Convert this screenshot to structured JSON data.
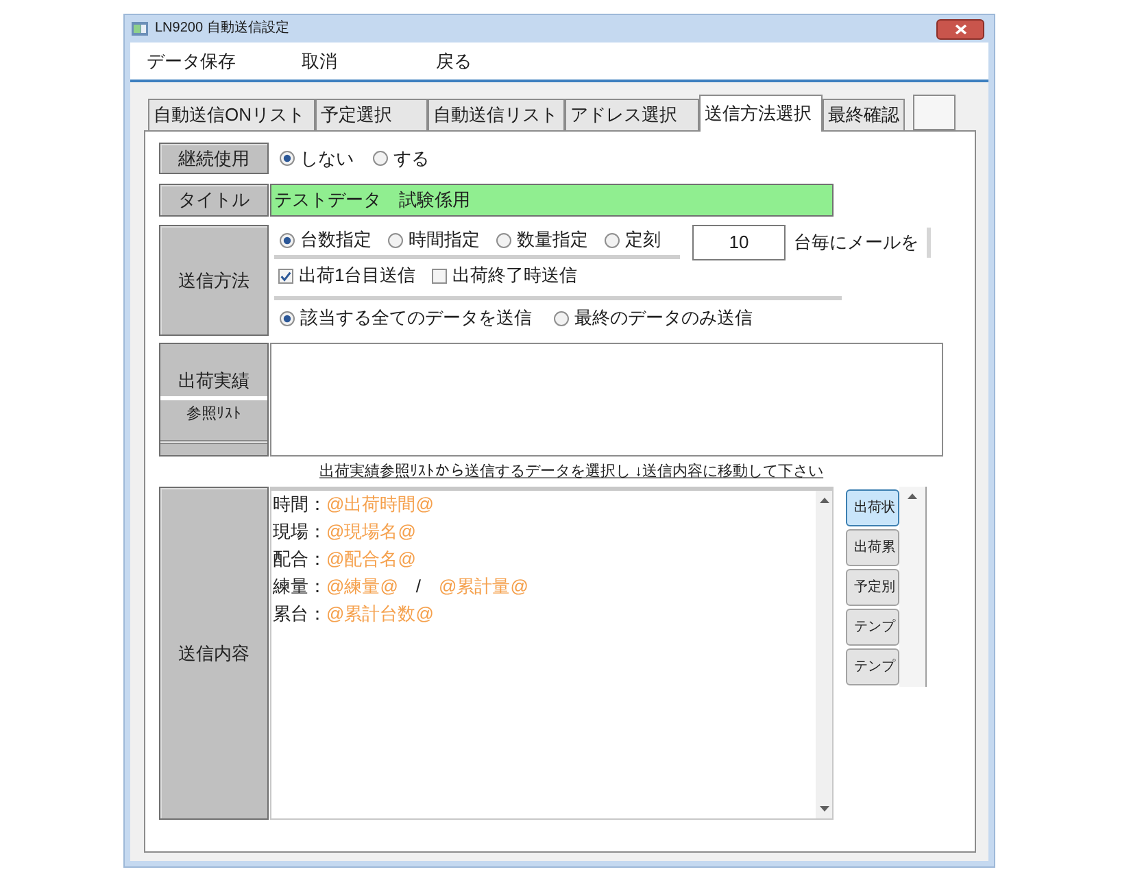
{
  "window": {
    "title": "LN9200 自動送信設定"
  },
  "menu": [
    "データ保存",
    "取消",
    "戻る"
  ],
  "tabs": [
    {
      "label": "自動送信ONリスト",
      "selected": false
    },
    {
      "label": "予定選択",
      "selected": false
    },
    {
      "label": "自動送信リスト",
      "selected": false
    },
    {
      "label": "アドレス選択",
      "selected": false
    },
    {
      "label": "送信方法選択",
      "selected": true
    },
    {
      "label": "最終確認",
      "selected": false
    }
  ],
  "form": {
    "continuous_use": {
      "label": "継続使用",
      "options": [
        {
          "label": "しない",
          "selected": true
        },
        {
          "label": "する",
          "selected": false
        }
      ]
    },
    "title": {
      "label": "タイトル",
      "value": "テストデータ　試験係用"
    },
    "send_method": {
      "label": "送信方法",
      "trigger_options": [
        {
          "label": "台数指定",
          "selected": true
        },
        {
          "label": "時間指定",
          "selected": false
        },
        {
          "label": "数量指定",
          "selected": false
        },
        {
          "label": "定刻",
          "selected": false
        }
      ],
      "interval": {
        "value": "10",
        "suffix": "台毎にメールを"
      },
      "send_timing": [
        {
          "label": "出荷1台目送信",
          "checked": true
        },
        {
          "label": "出荷終了時送信",
          "checked": false
        }
      ],
      "data_scope": [
        {
          "label": "該当する全てのデータを送信",
          "selected": true
        },
        {
          "label": "最終のデータのみ送信",
          "selected": false
        }
      ]
    },
    "reference_list": {
      "label": "出荷実績",
      "sublabel": "参照ﾘｽﾄ"
    },
    "hint": "出荷実績参照ﾘｽﾄから送信するデータを選択し ↓送信内容に移動して下さい",
    "message": {
      "label": "送信内容",
      "lines": [
        [
          {
            "kind": "text",
            "text": "時間："
          },
          {
            "kind": "field",
            "text": "@出荷時間@"
          }
        ],
        [
          {
            "kind": "text",
            "text": "現場："
          },
          {
            "kind": "field",
            "text": "@現場名@"
          }
        ],
        [
          {
            "kind": "text",
            "text": "配合："
          },
          {
            "kind": "field",
            "text": "@配合名@"
          }
        ],
        [
          {
            "kind": "text",
            "text": "練量："
          },
          {
            "kind": "field",
            "text": "@練量@"
          },
          {
            "kind": "text",
            "text": "　/　"
          },
          {
            "kind": "field",
            "text": "@累計量@"
          }
        ],
        [
          {
            "kind": "text",
            "text": "累台："
          },
          {
            "kind": "field",
            "text": "@累計台数@"
          }
        ]
      ],
      "template_buttons": [
        {
          "label": "出荷状",
          "selected": true
        },
        {
          "label": "出荷累",
          "selected": false
        },
        {
          "label": "予定別",
          "selected": false
        },
        {
          "label": "テンプ",
          "selected": false
        },
        {
          "label": "テンプ",
          "selected": false
        }
      ]
    }
  }
}
